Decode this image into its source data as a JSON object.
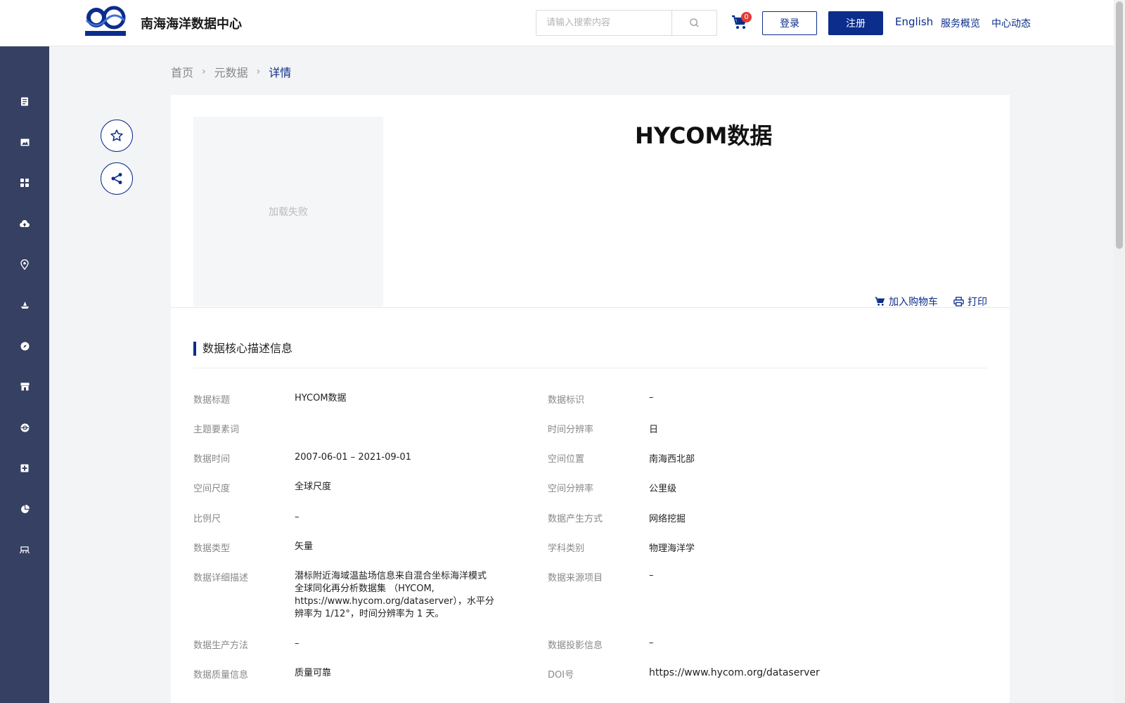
{
  "header": {
    "site_title": "南海海洋数据中心",
    "search_placeholder": "请输入搜索内容",
    "cart_count": "0",
    "login_label": "登录",
    "register_label": "注册",
    "english_label": "English",
    "overview_label": "服务概览",
    "news_label": "中心动态",
    "brand_color": "#0b2d8c"
  },
  "sidebar": {
    "items": [
      "document-icon",
      "image-icon",
      "grid-icon",
      "cloud-upload-icon",
      "location-pin-icon",
      "ship-icon",
      "compass-icon",
      "store-icon",
      "globe-icon",
      "medical-icon",
      "pie-chart-icon",
      "instrument-icon"
    ]
  },
  "breadcrumb": {
    "home": "首页",
    "metadata": "元数据",
    "current": "详情"
  },
  "detail": {
    "title": "HYCOM数据",
    "image_status": "加载失败",
    "add_to_cart": "加入购物车",
    "print": "打印"
  },
  "section": {
    "title": "数据核心描述信息"
  },
  "fields": {
    "data_title": {
      "label": "数据标题",
      "value": "HYCOM数据"
    },
    "data_id": {
      "label": "数据标识",
      "value": "–"
    },
    "keywords": {
      "label": "主题要素词",
      "value": ""
    },
    "time_res": {
      "label": "时间分辨率",
      "value": "日"
    },
    "data_time": {
      "label": "数据时间",
      "value": "2007-06-01 – 2021-09-01"
    },
    "location": {
      "label": "空间位置",
      "value": "南海西北部"
    },
    "scale_dim": {
      "label": "空间尺度",
      "value": "全球尺度"
    },
    "space_res": {
      "label": "空间分辨率",
      "value": "公里级"
    },
    "scale": {
      "label": "比例尺",
      "value": "–"
    },
    "gen_method": {
      "label": "数据产生方式",
      "value": "网络挖掘"
    },
    "data_type": {
      "label": "数据类型",
      "value": "矢量"
    },
    "discipline": {
      "label": "学科类别",
      "value": "物理海洋学"
    },
    "description": {
      "label": "数据详细描述",
      "value": "潜标附近海域温盐场信息来自混合坐标海洋模式全球同化再分析数据集 （HYCOM, https://www.hycom.org/dataserver），水平分辨率为 1/12°，时间分辨率为 1 天。"
    },
    "source_project": {
      "label": "数据来源项目",
      "value": "–"
    },
    "production": {
      "label": "数据生产方法",
      "value": "–"
    },
    "projection": {
      "label": "数据投影信息",
      "value": "–"
    },
    "quality": {
      "label": "数据质量信息",
      "value": "质量可靠"
    },
    "doi": {
      "label": "DOI号",
      "value": "https://www.hycom.org/dataserver"
    }
  }
}
